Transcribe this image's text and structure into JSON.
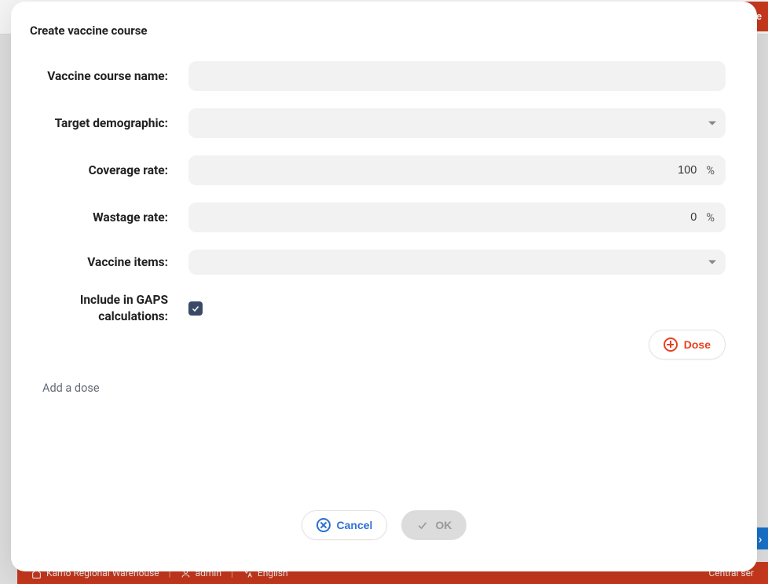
{
  "modal": {
    "title": "Create vaccine course"
  },
  "form": {
    "labels": {
      "name": "Vaccine course name:",
      "demographic": "Target demographic:",
      "coverage": "Coverage rate:",
      "wastage": "Wastage rate:",
      "items": "Vaccine items:",
      "gaps": "Include in GAPS calculations:"
    },
    "values": {
      "name": "",
      "demographic": "",
      "coverage": "100",
      "wastage": "0",
      "items": "",
      "gaps_checked": true
    },
    "suffix_percent": "%"
  },
  "buttons": {
    "dose": "Dose",
    "cancel": "Cancel",
    "ok": "OK"
  },
  "hint": {
    "add_dose": "Add a dose"
  },
  "background": {
    "topbar_button_fragment": "urse",
    "chevron": "›",
    "bottombar": {
      "warehouse": "Kamo Regional Warehouse",
      "user": "admin",
      "language": "English",
      "right_fragment": "Central ser"
    }
  },
  "icons": {
    "plus_circle": "plus-circle-icon",
    "x_circle": "x-circle-icon",
    "check": "check-icon",
    "caret_down": "caret-down-icon",
    "home": "home-icon",
    "user": "user-icon",
    "language": "language-icon"
  }
}
